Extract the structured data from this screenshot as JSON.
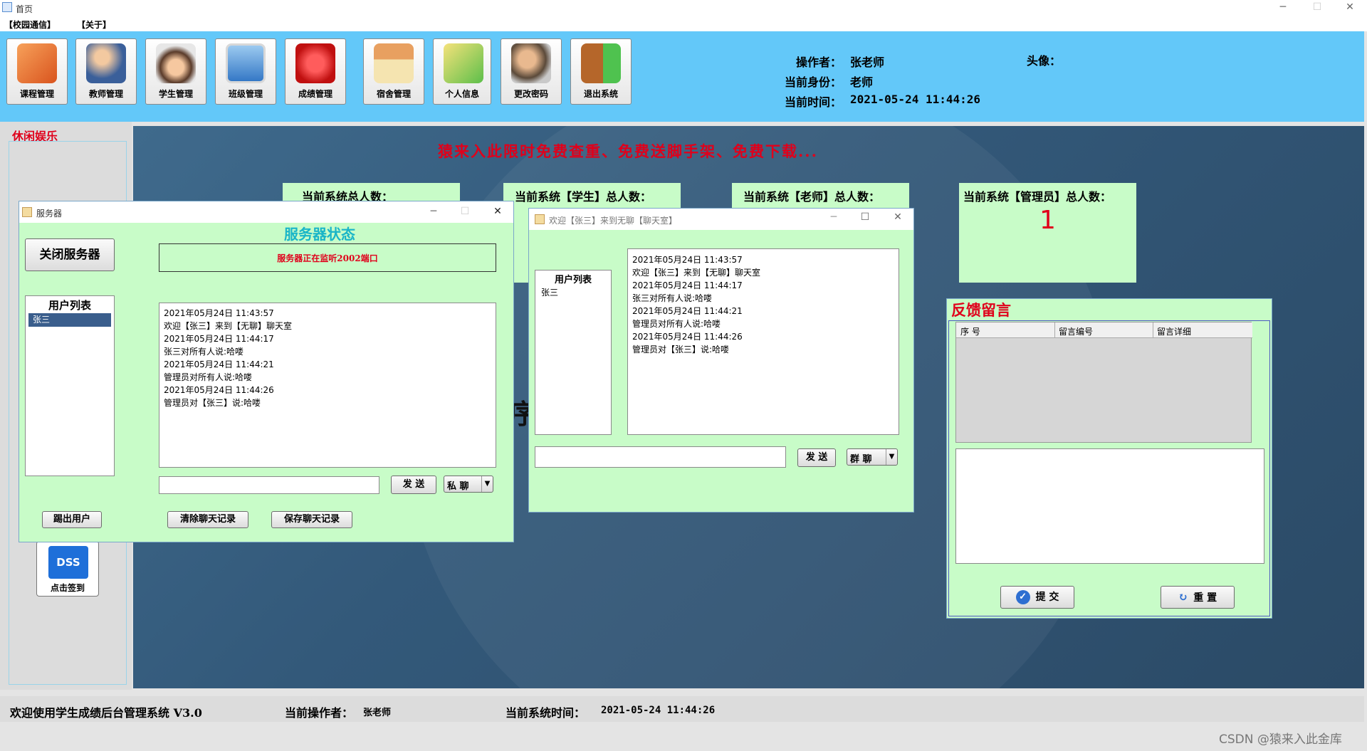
{
  "window": {
    "title": "首页"
  },
  "menu": [
    "【校园通信】",
    "【关于】"
  ],
  "toolbar": {
    "buttons": [
      {
        "label": "课程管理",
        "icon": "folder-icon"
      },
      {
        "label": "教师管理",
        "icon": "teachers-icon"
      },
      {
        "label": "学生管理",
        "icon": "student-icon"
      },
      {
        "label": "班级管理",
        "icon": "computer-icon"
      },
      {
        "label": "成绩管理",
        "icon": "grades-icon"
      },
      {
        "label": "宿舍管理",
        "icon": "dorm-house-icon"
      },
      {
        "label": "个人信息",
        "icon": "personal-info-icon"
      },
      {
        "label": "更改密码",
        "icon": "lock-user-icon"
      },
      {
        "label": "退出系统",
        "icon": "exit-door-icon"
      }
    ],
    "operator_label": "操作者：",
    "operator": "张老师",
    "role_label": "当前身份：",
    "role": "老师",
    "time_label": "当前时间：",
    "time": "2021-05-24 11:44:26",
    "avatar_label": "头像："
  },
  "sidebar": {
    "title": "休闲娱乐",
    "sign_badge": "DSS",
    "sign_label": "点击签到"
  },
  "main": {
    "banner": "猿来入此限时免费查重、免费送脚手架、免费下载...",
    "partial_char": "序",
    "stats": [
      {
        "label": "当前系统总人数：",
        "value": ""
      },
      {
        "label": "当前系统【学生】总人数：",
        "value": ""
      },
      {
        "label": "当前系统【老师】总人数：",
        "value": ""
      },
      {
        "label": "当前系统【管理员】总人数：",
        "value": "1"
      }
    ]
  },
  "server_window": {
    "title": "服务器",
    "close_server": "关闭服务器",
    "status_heading": "服务器状态",
    "status_text": "服务器正在监听2002端口",
    "user_list_title": "用户列表",
    "users": [
      "张三"
    ],
    "messages": [
      "2021年05月24日  11:43:57",
      "欢迎【张三】来到【无聊】聊天室",
      "2021年05月24日  11:44:17",
      "张三对所有人说:哈喽",
      "2021年05月24日  11:44:21",
      "管理员对所有人说:哈喽",
      "2021年05月24日  11:44:26",
      "管理员对【张三】说:哈喽"
    ],
    "input_value": "",
    "send": "发 送",
    "mode": "私  聊",
    "kick": "踢出用户",
    "clear": "清除聊天记录",
    "save": "保存聊天记录"
  },
  "chat_window": {
    "title": "欢迎【张三】来到无聊【聊天室】",
    "user_list_title": "用户列表",
    "users": [
      "张三"
    ],
    "messages": [
      "2021年05月24日  11:43:57",
      "欢迎【张三】来到【无聊】聊天室",
      "2021年05月24日  11:44:17",
      "张三对所有人说:哈喽",
      "2021年05月24日  11:44:21",
      "管理员对所有人说:哈喽",
      "2021年05月24日  11:44:26",
      "管理员对【张三】说:哈喽"
    ],
    "input_value": "",
    "send": "发 送",
    "mode": "群  聊"
  },
  "feedback": {
    "title": "反馈留言",
    "columns": [
      "序  号",
      "留言编号",
      "留言详细"
    ],
    "rows": [],
    "textarea_value": "",
    "submit": "提  交",
    "reset": "重  置"
  },
  "statusbar": {
    "welcome": "欢迎使用学生成绩后台管理系统  V3.0",
    "operator_label": "当前操作者：",
    "operator": "张老师",
    "time_label": "当前系统时间：",
    "time": "2021-05-24 11:44:26"
  },
  "watermark": "CSDN @猿来入此金库",
  "colors": {
    "toolbar_bg": "#63c8f9",
    "panel_green": "#c8fcc8",
    "accent_red": "#e0001b",
    "heading_cyan": "#19b5c8"
  }
}
